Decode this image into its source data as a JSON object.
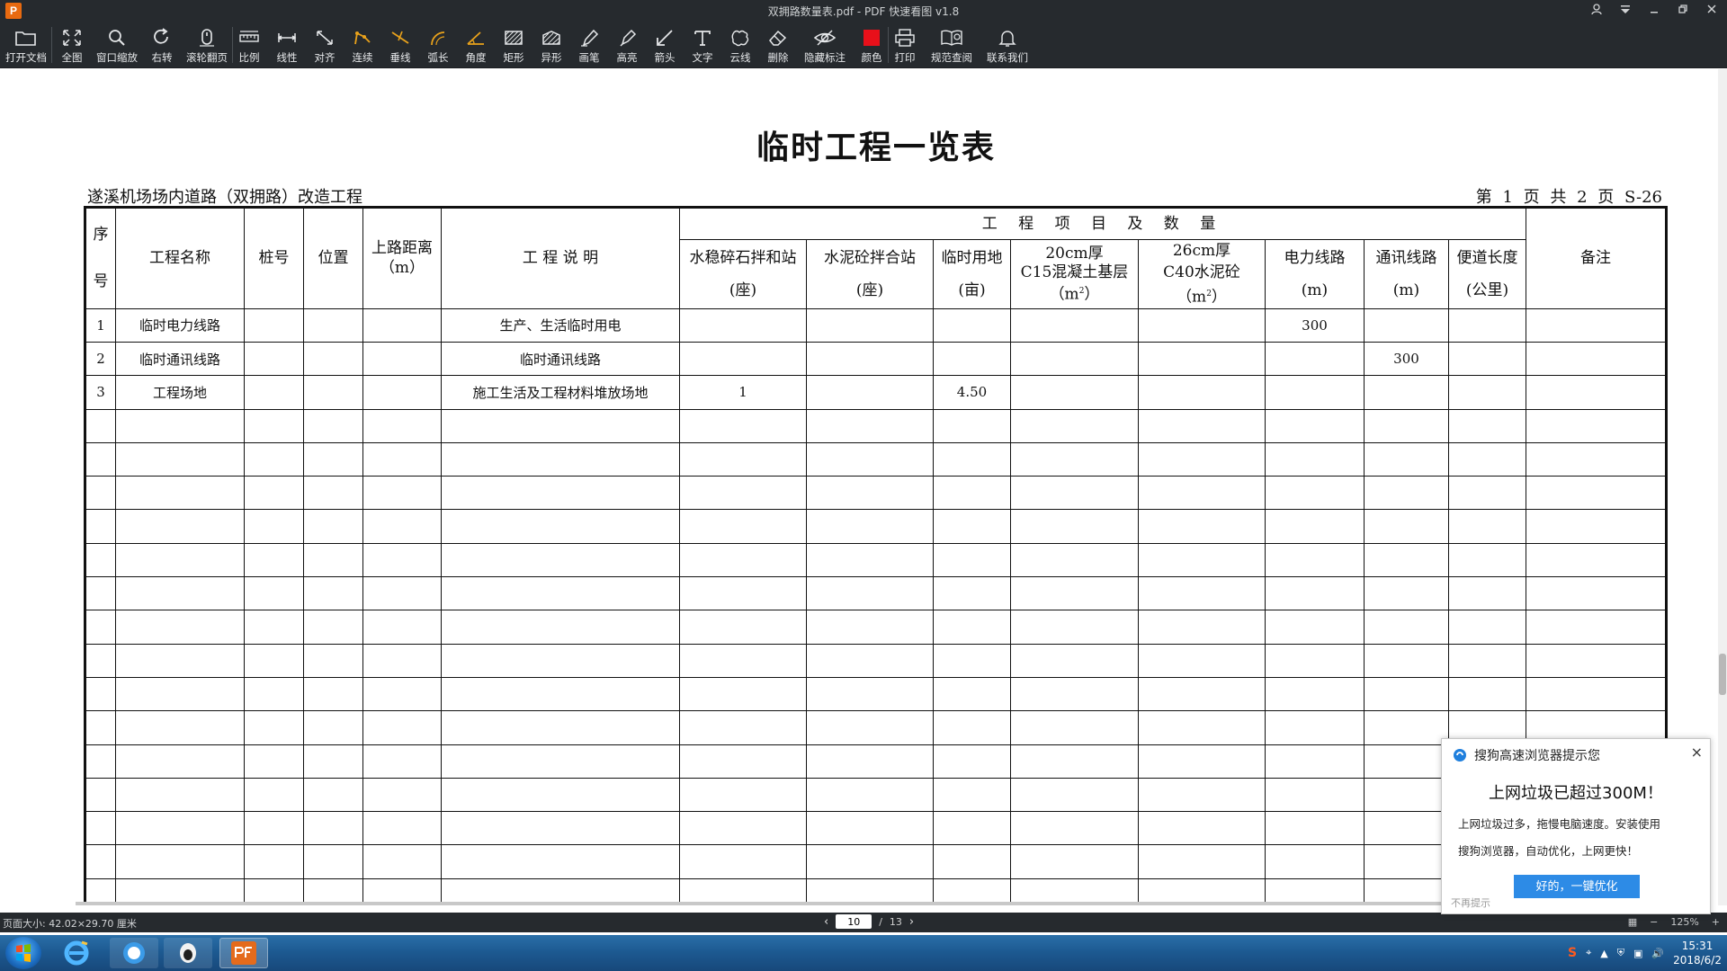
{
  "window": {
    "app_icon": "P",
    "title": "双拥路数量表.pdf - PDF 快速看图 v1.8"
  },
  "toolbar": {
    "items": [
      {
        "label": "打开文档",
        "icon": "folder-icon"
      },
      {
        "label": "全图",
        "icon": "fullscreen-icon"
      },
      {
        "label": "窗口缩放",
        "icon": "zoom-icon"
      },
      {
        "label": "右转",
        "icon": "rotate-icon"
      },
      {
        "label": "滚轮翻页",
        "icon": "mouse-wheel-icon"
      },
      {
        "label": "比例",
        "icon": "scale-icon"
      },
      {
        "label": "线性",
        "icon": "linear-icon"
      },
      {
        "label": "对齐",
        "icon": "align-icon"
      },
      {
        "label": "连续",
        "icon": "continuous-icon"
      },
      {
        "label": "垂线",
        "icon": "perpendicular-icon"
      },
      {
        "label": "弧长",
        "icon": "arc-length-icon"
      },
      {
        "label": "角度",
        "icon": "angle-icon"
      },
      {
        "label": "矩形",
        "icon": "rectangle-icon"
      },
      {
        "label": "异形",
        "icon": "polygon-icon"
      },
      {
        "label": "画笔",
        "icon": "pen-icon"
      },
      {
        "label": "高亮",
        "icon": "highlighter-icon"
      },
      {
        "label": "箭头",
        "icon": "arrow-icon"
      },
      {
        "label": "文字",
        "icon": "text-icon"
      },
      {
        "label": "云线",
        "icon": "cloud-line-icon"
      },
      {
        "label": "删除",
        "icon": "eraser-icon"
      },
      {
        "label": "隐藏标注",
        "icon": "hide-annotation-icon"
      },
      {
        "label": "颜色",
        "icon": "color-icon",
        "color": "#e8101a"
      },
      {
        "label": "打印",
        "icon": "print-icon"
      },
      {
        "label": "规范查阅",
        "icon": "spec-book-icon"
      },
      {
        "label": "联系我们",
        "icon": "contact-bell-icon"
      }
    ]
  },
  "document": {
    "title": "临时工程一览表",
    "project_name": "遂溪机场场内道路（双拥路）改造工程",
    "page_info": "第 1 页  共 2 页  S-26",
    "table": {
      "headers": {
        "seq_top": "序",
        "seq_bottom": "号",
        "name": "工程名称",
        "stake": "桩号",
        "position": "位置",
        "distance": "上路距离",
        "distance_unit": "（m）",
        "description": "工 程 说 明",
        "group": "工 程 项 目 及 数 量",
        "remarks": "备注",
        "stone_mix_station": "水稳碎石拌和站",
        "stone_mix_unit": "(座)",
        "cement_mix_station": "水泥砼拌合站",
        "cement_mix_unit": "(座)",
        "temp_land": "临时用地",
        "temp_land_unit": "(亩)",
        "c15_line1": "20cm厚",
        "c15_line2": "C15混凝土基层",
        "c15_unit": "（m",
        "c15_unit_sup": "2",
        "c15_unit_close": "）",
        "c40_line1": "26cm厚",
        "c40_line2": "C40水泥砼（m",
        "c40_unit_sup": "2",
        "c40_unit_close": "）",
        "power_line": "电力线路",
        "power_unit": "(m)",
        "comm_line": "通讯线路",
        "comm_unit": "(m)",
        "access_road": "便道长度",
        "access_unit": "(公里)"
      },
      "rows": [
        {
          "seq": "1",
          "name": "临时电力线路",
          "stake": "",
          "position": "",
          "distance": "",
          "description": "生产、生活临时用电",
          "stone_mix": "",
          "cement_mix": "",
          "temp_land": "",
          "c15": "",
          "c40": "",
          "power": "300",
          "comm": "",
          "access": "",
          "remarks": ""
        },
        {
          "seq": "2",
          "name": "临时通讯线路",
          "stake": "",
          "position": "",
          "distance": "",
          "description": "临时通讯线路",
          "stone_mix": "",
          "cement_mix": "",
          "temp_land": "",
          "c15": "",
          "c40": "",
          "power": "",
          "comm": "300",
          "access": "",
          "remarks": ""
        },
        {
          "seq": "3",
          "name": "工程场地",
          "stake": "",
          "position": "",
          "distance": "",
          "description": "施工生活及工程材料堆放场地",
          "stone_mix": "1",
          "cement_mix": "",
          "temp_land": "4.50",
          "c15": "",
          "c40": "",
          "power": "",
          "comm": "",
          "access": "",
          "remarks": ""
        }
      ],
      "empty_row_count": 15
    }
  },
  "statusbar": {
    "page_size": "页面大小: 42.02×29.70 厘米",
    "current_page": "10",
    "separator": "/",
    "total_pages": "13",
    "zoom": "125%"
  },
  "popup": {
    "title": "搜狗高速浏览器提示您",
    "headline": "上网垃圾已超过300M！",
    "body_line1": "上网垃圾过多，拖慢电脑速度。安装使用",
    "body_line2": "搜狗浏览器，自动优化，上网更快！",
    "ok_button": "好的，一键优化",
    "no_remind": "不再提示",
    "close": "×"
  },
  "taskbar": {
    "time": "15:31",
    "date": "2018/6/2",
    "tray_s_icon": "S"
  }
}
